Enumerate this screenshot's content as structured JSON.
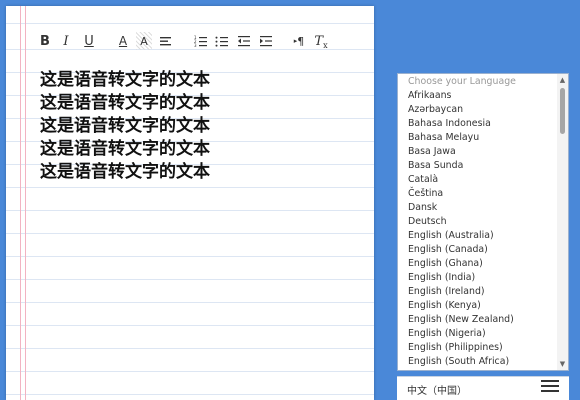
{
  "toolbar": {
    "bold_label": "B",
    "italic_label": "I",
    "underline_label": "U",
    "font_color_label": "A",
    "highlight_label": "A",
    "align_label": "",
    "ordered_list_label": "",
    "bullet_list_label": "",
    "outdent_label": "",
    "indent_label": "",
    "text_direction_label": "¶",
    "clear_format_label": "T"
  },
  "editor": {
    "lines": [
      "这是语音转文字的文本",
      "这是语音转文字的文本",
      "这是语音转文字的文本",
      "这是语音转文字的文本",
      "这是语音转文字的文本"
    ]
  },
  "language_list": {
    "placeholder": "Choose your Language",
    "options": [
      "Afrikaans",
      "Azərbaycan",
      "Bahasa Indonesia",
      "Bahasa Melayu",
      "Basa Jawa",
      "Basa Sunda",
      "Català",
      "Čeština",
      "Dansk",
      "Deutsch",
      "English (Australia)",
      "English (Canada)",
      "English (Ghana)",
      "English (India)",
      "English (Ireland)",
      "English (Kenya)",
      "English (New Zealand)",
      "English (Nigeria)",
      "English (Philippines)",
      "English (South Africa)"
    ]
  },
  "bottom_bar": {
    "selected_language": "中文（中国）",
    "menu_icon": "hamburger-menu-icon"
  },
  "colors": {
    "background": "#4a88d8",
    "margin_line": "#f2b3c2",
    "rule_line": "#dde6f3"
  }
}
